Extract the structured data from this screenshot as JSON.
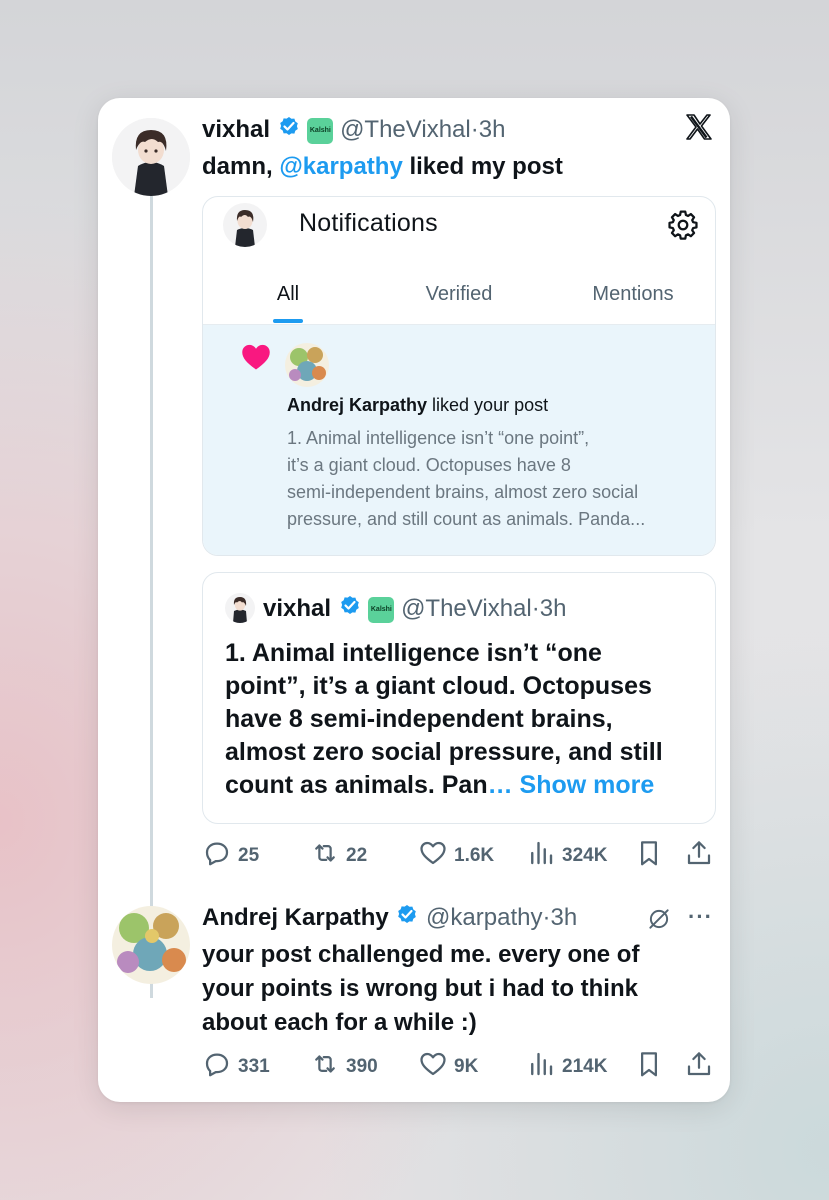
{
  "tweet": {
    "author_name": "vixhal",
    "badge_label": "Kalshi",
    "handle": "@TheVixhal",
    "separator": "·",
    "time": "3h",
    "text_before": "damn, ",
    "mention": "@karpathy",
    "text_after": " liked my post",
    "notifications": {
      "title": "Notifications",
      "tabs": [
        "All",
        "Verified",
        "Mentions"
      ],
      "active_tab": "All",
      "item": {
        "liker_name": "Andrej Karpathy",
        "action": " liked your post",
        "preview_lines": [
          "1. Animal intelligence isn’t “one point”,",
          "it’s a giant cloud. Octopuses have 8",
          "semi-independent brains, almost zero social",
          "pressure, and still count as animals. Panda..."
        ]
      }
    },
    "quote": {
      "author_name": "vixhal",
      "badge_label": "Kalshi",
      "handle": "@TheVixhal",
      "separator": "·",
      "time": "3h",
      "lines": [
        "1. Animal intelligence isn’t “one",
        "point”, it’s a giant cloud. Octopuses",
        "have 8 semi-independent brains,",
        "almost zero social pressure, and still",
        "count as animals. Pan"
      ],
      "ellipsis": "…",
      "show_more": " Show more"
    },
    "actions": {
      "replies": "25",
      "reposts": "22",
      "likes": "1.6K",
      "views": "324K"
    }
  },
  "reply": {
    "author_name": "Andrej Karpathy",
    "handle": "@karpathy",
    "separator": "·",
    "time": "3h",
    "more": "···",
    "lines": [
      "your post challenged me. every one of",
      "your points is wrong but i had to think",
      "about each for a while :)"
    ],
    "actions": {
      "replies": "331",
      "reposts": "390",
      "likes": "9K",
      "views": "214K"
    }
  },
  "colors": {
    "accent": "#1d9bf0",
    "heart": "#f91880",
    "text": "#0f1419",
    "muted": "#536471",
    "notif_bg": "#eaf5fb"
  },
  "icons": [
    "x-logo-icon",
    "verified-badge-icon",
    "gear-icon",
    "heart-icon",
    "reply-icon",
    "repost-icon",
    "like-icon",
    "views-icon",
    "bookmark-icon",
    "share-icon",
    "mute-icon",
    "more-icon"
  ]
}
